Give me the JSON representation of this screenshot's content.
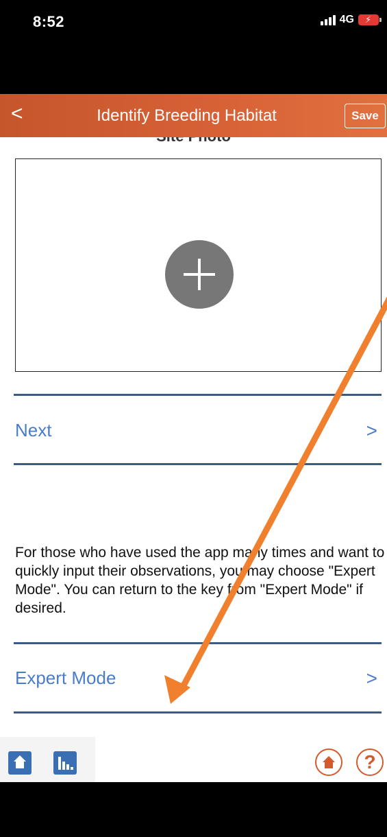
{
  "status_bar": {
    "time": "8:52",
    "network": "4G"
  },
  "navbar": {
    "back_icon": "chevron-left-icon",
    "back_glyph": "<",
    "title": "Identify Breeding Habitat",
    "save_label": "Save",
    "background_color": "#d76136"
  },
  "photo_section": {
    "heading": "Site Photo",
    "add_icon": "plus-icon"
  },
  "next_row": {
    "label": "Next",
    "chevron": ">"
  },
  "description": "For those who have used the app many times and want to quickly input their observations, you may choose \"Expert Mode\". You can return to the key from \"Expert Mode\" if desired.",
  "expert_row": {
    "label": "Expert Mode",
    "chevron": ">"
  },
  "footer": {
    "help_label": "?",
    "accent_color": "#d25a2c",
    "blue_color": "#3b6fb4"
  },
  "annotation": {
    "arrow_color": "#f07f2e"
  }
}
